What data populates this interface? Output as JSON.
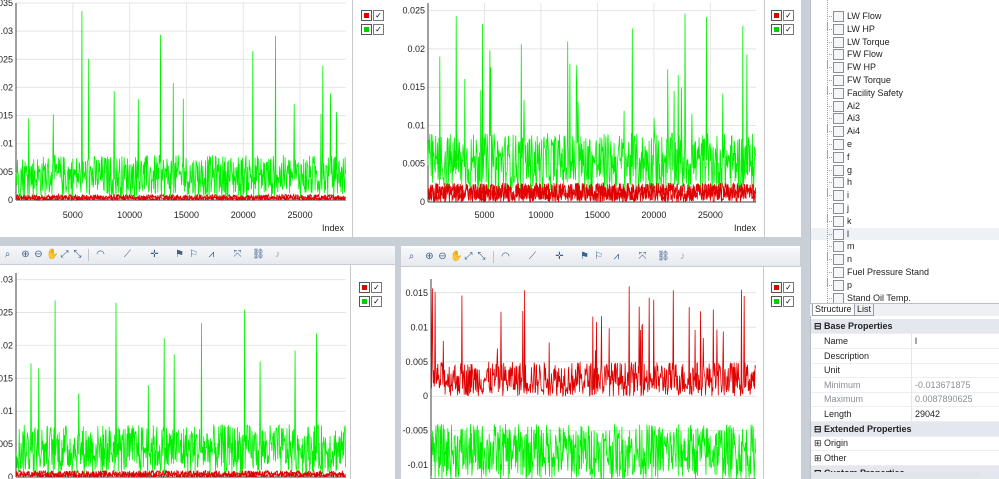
{
  "colors": {
    "red": "#e00000",
    "green": "#00f000",
    "grid": "#e4e4e4",
    "axis": "#404040"
  },
  "charts": [
    {
      "id": "top-left",
      "xlabel": "Index",
      "yticks": [
        "0",
        ".005",
        ".01",
        ".015",
        ".02",
        ".025",
        ".03",
        ".035"
      ],
      "xticks": [
        "5000",
        "10000",
        "15000",
        "20000",
        "25000"
      ]
    },
    {
      "id": "top-right",
      "xlabel": "Index",
      "yticks": [
        "0",
        "0.005",
        "0.01",
        "0.015",
        "0.02",
        "0.025"
      ],
      "xticks": [
        "5000",
        "10000",
        "15000",
        "20000",
        "25000"
      ]
    },
    {
      "id": "bottom-left",
      "xlabel": "",
      "yticks": [
        "0",
        ".005",
        ".01",
        ".015",
        ".02",
        ".025",
        ".03"
      ],
      "xticks": []
    },
    {
      "id": "bottom-right",
      "xlabel": "",
      "yticks": [
        "-0.01",
        "-0.005",
        "0",
        "0.005",
        "0.01",
        "0.015"
      ],
      "xticks": []
    }
  ],
  "chart_data": [
    {
      "type": "line",
      "title": "",
      "xlabel": "Index",
      "ylabel": "",
      "xlim": [
        0,
        29042
      ],
      "ylim": [
        0,
        0.035
      ],
      "series": [
        {
          "values_summary": "noise 0.0005–0.008 with spikes up to 0.035"
        },
        {
          "values_summary": "near 0 to 0.001"
        }
      ]
    },
    {
      "type": "line",
      "title": "",
      "xlabel": "Index",
      "ylabel": "",
      "xlim": [
        0,
        29042
      ],
      "ylim": [
        0,
        0.026
      ],
      "series": [
        {
          "values_summary": "noise 0.0015–0.009 with spikes up to 0.025"
        },
        {
          "values_summary": "band 0–0.0025"
        }
      ]
    },
    {
      "type": "line",
      "title": "",
      "xlabel": "",
      "ylabel": "",
      "xlim": [
        0,
        29042
      ],
      "ylim": [
        0,
        0.031
      ],
      "series": [
        {
          "values_summary": "noise 0.0005–0.008 with spikes up to 0.03"
        },
        {
          "values_summary": "near 0 to 0.001"
        }
      ]
    },
    {
      "type": "line",
      "title": "",
      "xlabel": "",
      "ylabel": "",
      "xlim": [
        0,
        29042
      ],
      "ylim": [
        -0.012,
        0.017
      ],
      "series": [
        {
          "values_summary": "noise -0.012 to -0.004"
        },
        {
          "values_summary": "band 0 to 0.005 with spikes to 0.015"
        }
      ]
    }
  ],
  "tree": {
    "items": [
      "LW Flow",
      "LW HP",
      "LW Torque",
      "FW Flow",
      "FW HP",
      "FW Torque",
      "Facility Safety",
      "Ai2",
      "Ai3",
      "Ai4",
      "e",
      "f",
      "g",
      "h",
      "i",
      "j",
      "k",
      "l",
      "m",
      "n",
      "Fuel Pressure Stand",
      "p",
      "Stand Oil Temp."
    ]
  },
  "tabs": {
    "structure": "Structure",
    "list": "List"
  },
  "props": {
    "base_header": "Base Properties",
    "rows": [
      {
        "key": "Name",
        "value": "l"
      },
      {
        "key": "Description",
        "value": ""
      },
      {
        "key": "Unit",
        "value": ""
      },
      {
        "key": "Minimum",
        "value": "-0.013671875"
      },
      {
        "key": "Maximum",
        "value": "0.0087890625"
      },
      {
        "key": "Length",
        "value": "29042"
      }
    ],
    "extended_header": "Extended Properties",
    "origin": "Origin",
    "other": "Other",
    "custom": "Custom Properties"
  }
}
